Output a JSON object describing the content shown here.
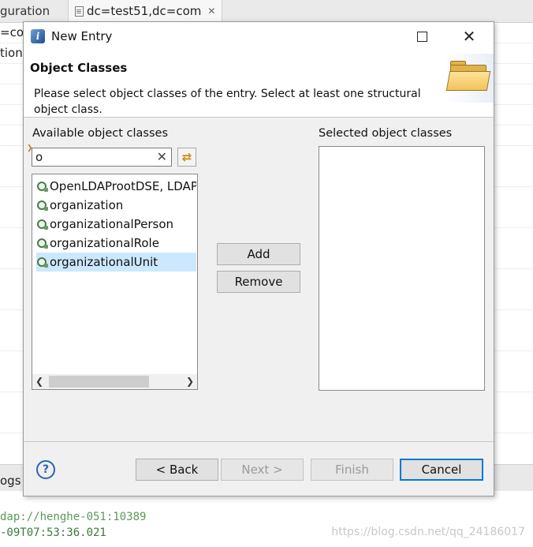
{
  "background": {
    "tab1_label": "guration",
    "tab2_label": "dc=test51,dc=com",
    "row1_text": "=cor",
    "row2_text": "tion",
    "bottom_tab_label": "ogs",
    "console_line1": "dap://henghe-051:10389",
    "console_line2": "-09T07:53:36.021",
    "watermark": "https://blog.csdn.net/qq_24186017"
  },
  "dialog": {
    "title": "New Entry",
    "window_controls": {
      "maximize": "maximize-icon",
      "close": "✕"
    },
    "page_title": "Object Classes",
    "description": "Please select object classes of the entry. Select at least one structural object class.",
    "available_label": "Available object classes",
    "selected_label": "Selected object classes",
    "filter_value": "o",
    "available_items": [
      {
        "label": "OpenLDAProotDSE, LDAP",
        "selected": false
      },
      {
        "label": "organization",
        "selected": false
      },
      {
        "label": "organizationalPerson",
        "selected": false
      },
      {
        "label": "organizationalRole",
        "selected": false
      },
      {
        "label": "organizationalUnit",
        "selected": true
      }
    ],
    "selected_items": [],
    "add_label": "Add",
    "remove_label": "Remove",
    "back_label": "< Back",
    "next_label": "Next >",
    "finish_label": "Finish",
    "cancel_label": "Cancel",
    "help_label": "?"
  }
}
